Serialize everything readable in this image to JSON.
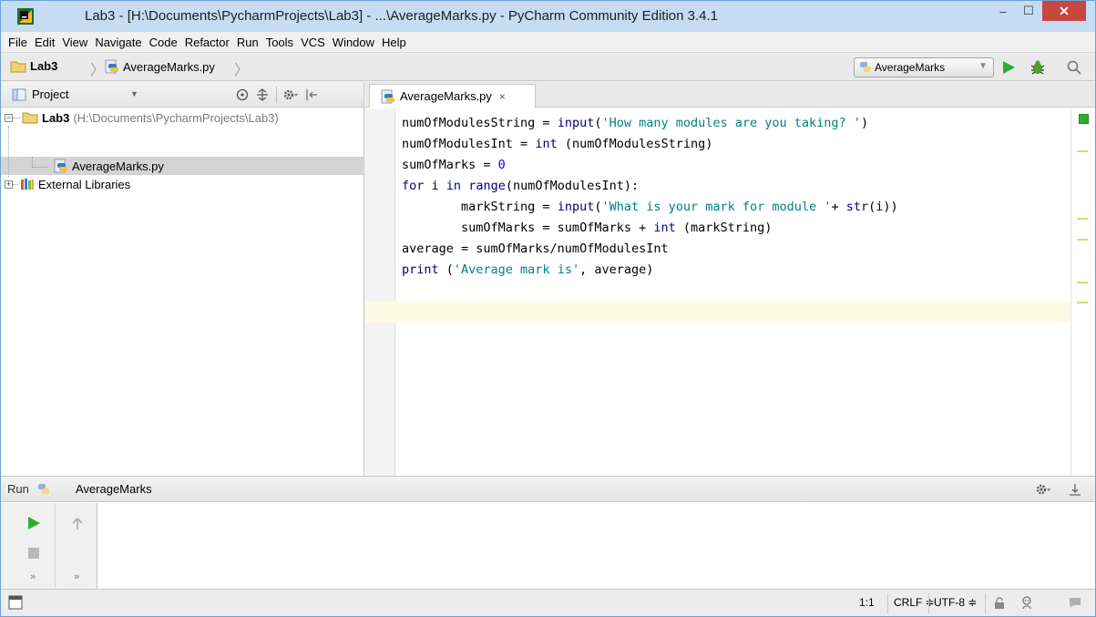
{
  "window": {
    "title": "Lab3 - [H:\\Documents\\PycharmProjects\\Lab3] - ...\\AverageMarks.py - PyCharm Community Edition 3.4.1",
    "min_label": "–",
    "max_label": "☐",
    "close_label": "✕"
  },
  "menu": [
    "File",
    "Edit",
    "View",
    "Navigate",
    "Code",
    "Refactor",
    "Run",
    "Tools",
    "VCS",
    "Window",
    "Help"
  ],
  "breadcrumb": {
    "project": "Lab3",
    "file": "AverageMarks.py"
  },
  "run_config": {
    "selected": "AverageMarks"
  },
  "project_panel": {
    "title": "Project",
    "root": {
      "name": "Lab3",
      "path": "(H:\\Documents\\PycharmProjects\\Lab3)"
    },
    "file": "AverageMarks.py",
    "external": "External Libraries"
  },
  "editor": {
    "tab_label": "AverageMarks.py",
    "tab_close": "×",
    "lines": [
      "numOfModulesString = input('How many modules are you taking? ')",
      "numOfModulesInt = int (numOfModulesString)",
      "sumOfMarks = 0",
      "for i in range(numOfModulesInt):",
      "        markString = input('What is your mark for module '+ str(i))",
      "        sumOfMarks = sumOfMarks + int (markString)",
      "average = sumOfMarks/numOfModulesInt",
      "print ('Average mark is', average)",
      ""
    ]
  },
  "run_panel": {
    "label": "Run",
    "config_name": "AverageMarks",
    "more1": "»",
    "more2": "»"
  },
  "status": {
    "position": "1:1",
    "line_sep": "CRLF ≑",
    "encoding": "UTF-8 ≑"
  },
  "colors": {
    "title_bg": "#c5dcf3",
    "close_bg": "#c7483f",
    "current_line": "#fffae3",
    "ok_mark": "#2eac2e",
    "run_green": "#2eac2e",
    "string": "#008080",
    "keyword": "#000080",
    "number": "#0000ff"
  }
}
